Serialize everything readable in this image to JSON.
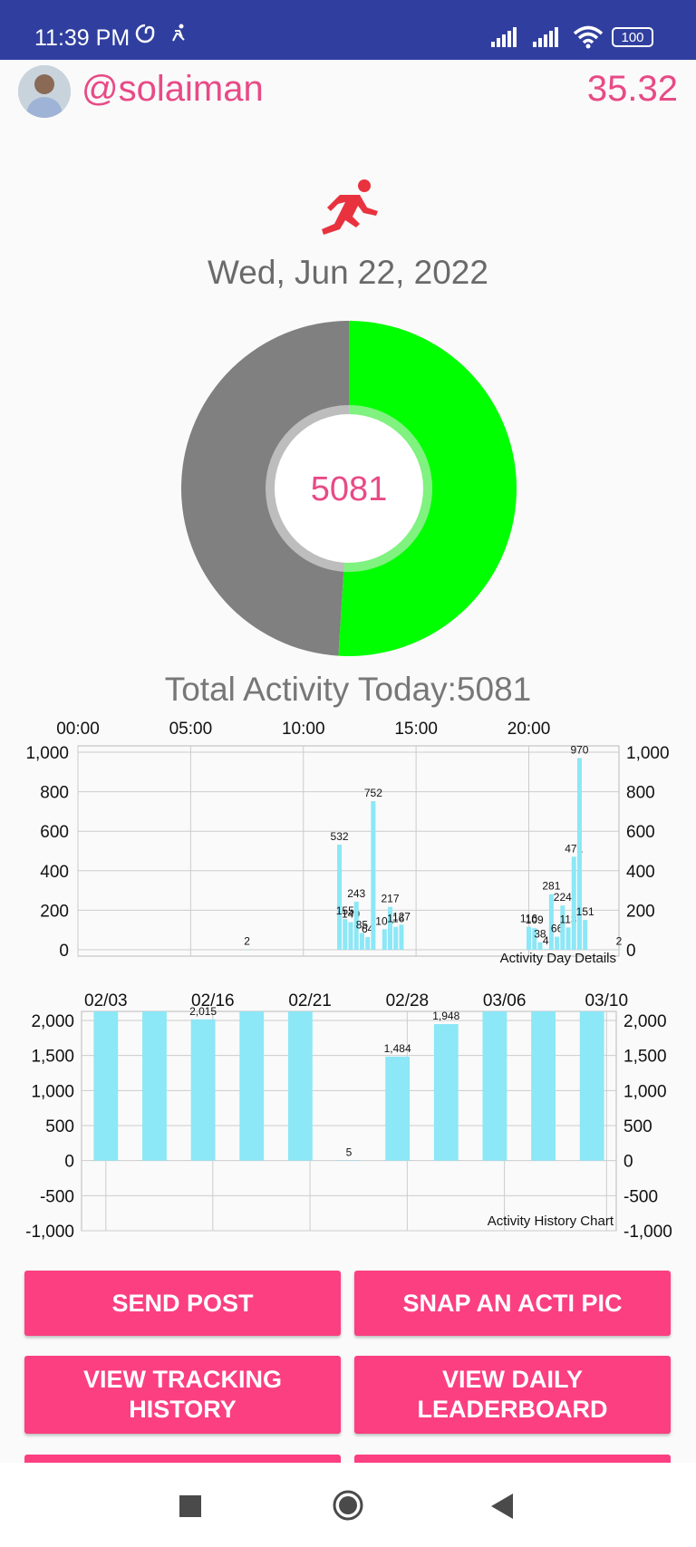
{
  "status_bar": {
    "time": "11:39 PM",
    "battery": "100",
    "icons": [
      "notification-app-icon",
      "activity-app-icon",
      "signal-icon",
      "signal-icon",
      "wifi-icon",
      "battery-icon"
    ]
  },
  "header": {
    "username": "@solaiman",
    "score": "35.32"
  },
  "activity": {
    "date": "Wed, Jun 22, 2022",
    "center_value": "5081",
    "total_label": "Total Activity Today:5081",
    "progress_fraction": 0.51,
    "colors": {
      "progress": "#00ff00",
      "remainder": "#808080",
      "accent": "#e84a86"
    }
  },
  "chart_data": [
    {
      "type": "bar",
      "description_label": "Activity Day Details",
      "x_tick_labels": [
        "00:00",
        "05:00",
        "10:00",
        "15:00",
        "20:00"
      ],
      "y_tick_labels": [
        "0",
        "200",
        "400",
        "600",
        "800",
        "1,000"
      ],
      "ylim": [
        0,
        1000
      ],
      "xlim_hours": [
        0,
        24
      ],
      "bar_color": "#8ce7f6",
      "points": [
        {
          "x": 7.5,
          "y": 2,
          "label": "2"
        },
        {
          "x": 11.6,
          "y": 532,
          "label": "532"
        },
        {
          "x": 11.85,
          "y": 155,
          "label": "155"
        },
        {
          "x": 12.1,
          "y": 140,
          "label": "140"
        },
        {
          "x": 12.35,
          "y": 243,
          "label": "243"
        },
        {
          "x": 12.6,
          "y": 85,
          "label": "85"
        },
        {
          "x": 12.85,
          "y": 64,
          "label": "64"
        },
        {
          "x": 13.1,
          "y": 752,
          "label": "752"
        },
        {
          "x": 13.6,
          "y": 104,
          "label": "104"
        },
        {
          "x": 13.85,
          "y": 217,
          "label": "217"
        },
        {
          "x": 14.1,
          "y": 116,
          "label": "116"
        },
        {
          "x": 14.35,
          "y": 127,
          "label": "127"
        },
        {
          "x": 20.0,
          "y": 116,
          "label": "116"
        },
        {
          "x": 20.25,
          "y": 109,
          "label": "109"
        },
        {
          "x": 20.5,
          "y": 38,
          "label": "38"
        },
        {
          "x": 20.75,
          "y": 4,
          "label": "4"
        },
        {
          "x": 21.0,
          "y": 281,
          "label": "281"
        },
        {
          "x": 21.25,
          "y": 66,
          "label": "66"
        },
        {
          "x": 21.5,
          "y": 224,
          "label": "224"
        },
        {
          "x": 21.75,
          "y": 113,
          "label": "113"
        },
        {
          "x": 22.0,
          "y": 471,
          "label": "471"
        },
        {
          "x": 22.25,
          "y": 970,
          "label": "970"
        },
        {
          "x": 22.5,
          "y": 151,
          "label": "151"
        },
        {
          "x": 24.0,
          "y": 2,
          "label": "2"
        }
      ]
    },
    {
      "type": "bar",
      "description_label": "Activity History Chart",
      "x_tick_labels": [
        "02/03",
        "02/16",
        "02/21",
        "02/28",
        "03/06",
        "03/10"
      ],
      "y_tick_labels": [
        "-1,000",
        "-500",
        "0",
        "500",
        "1,000",
        "1,500",
        "2,000"
      ],
      "ylim": [
        -1000,
        2000
      ],
      "bar_color": "#8ce7f6",
      "values": [
        2250,
        2250,
        2015,
        2250,
        2250,
        5,
        1484,
        1948,
        2250,
        2250,
        2250
      ],
      "labels": [
        "",
        "",
        "2,015",
        "",
        "",
        "5",
        "1,484",
        "1,948",
        "",
        "",
        ""
      ]
    }
  ],
  "buttons": [
    {
      "label": "SEND POST"
    },
    {
      "label": "SNAP AN ACTI PIC"
    },
    {
      "label": "VIEW TRACKING\nHISTORY"
    },
    {
      "label": "VIEW DAILY\nLEADERBOARD"
    }
  ],
  "nav_bar": {
    "icons": [
      "recents-square-icon",
      "home-circle-icon",
      "back-triangle-icon"
    ]
  }
}
